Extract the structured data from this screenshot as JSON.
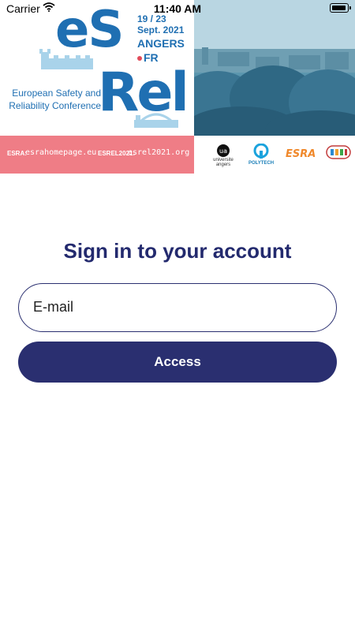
{
  "status_bar": {
    "carrier": "Carrier",
    "time": "11:40 AM",
    "wifi_icon": "wifi-icon",
    "battery_icon": "battery-icon"
  },
  "banner": {
    "brand_es": "eS",
    "brand_rel": "Rel",
    "dates_line1": "19 / 23",
    "dates_line2": "Sept. 2021",
    "city": "ANGERS",
    "country": "FR",
    "conference_line1": "European Safety and",
    "conference_line2": "Reliability Conference",
    "esra_label": "ESRA:",
    "esra_url": "esrahomepage.eu",
    "esrel_label": "ESREL2021:",
    "esrel_url": "esrel2021.org",
    "logo_ua_caption_1": "universite",
    "logo_ua_caption_2": "angers",
    "logo_polytech_caption": "POLYTECH",
    "logo_esra": "ESRA",
    "colors": {
      "brand_blue": "#1f6fb2",
      "pink": "#ef7d86",
      "esra_orange": "#f0892c"
    }
  },
  "signin": {
    "title": "Sign in to your account",
    "email_placeholder": "E-mail",
    "email_value": "",
    "access_label": "Access",
    "colors": {
      "primary": "#2a2f70",
      "title": "#232a6e"
    }
  }
}
